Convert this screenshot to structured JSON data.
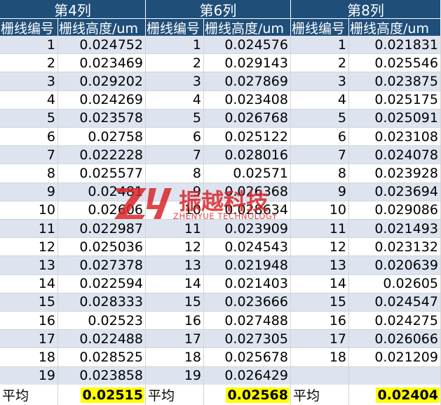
{
  "groups": [
    {
      "title": "第4列",
      "col_id": "栅线编号",
      "col_height": "栅线高度/um",
      "ids": [
        "1",
        "2",
        "3",
        "4",
        "5",
        "6",
        "7",
        "8",
        "9",
        "10",
        "11",
        "12",
        "13",
        "14",
        "15",
        "16",
        "17",
        "18",
        "19"
      ],
      "values": [
        "0.024752",
        "0.023469",
        "0.029202",
        "0.024269",
        "0.023578",
        "0.02758",
        "0.022228",
        "0.025577",
        "0.02481",
        "0.02606",
        "0.022987",
        "0.025036",
        "0.027378",
        "0.022594",
        "0.028333",
        "0.02523",
        "0.022488",
        "0.028525",
        "0.023858"
      ],
      "avg_label": "平均",
      "avg_value": "0.02515"
    },
    {
      "title": "第6列",
      "col_id": "栅线编号",
      "col_height": "栅线高度/um",
      "ids": [
        "1",
        "2",
        "3",
        "4",
        "5",
        "6",
        "7",
        "8",
        "9",
        "10",
        "11",
        "12",
        "13",
        "14",
        "15",
        "16",
        "17",
        "18",
        "19"
      ],
      "values": [
        "0.024576",
        "0.029143",
        "0.027869",
        "0.023408",
        "0.026768",
        "0.025122",
        "0.028016",
        "0.02571",
        "0.026368",
        "0.028634",
        "0.023909",
        "0.024543",
        "0.021948",
        "0.021403",
        "0.023666",
        "0.027488",
        "0.027305",
        "0.025678",
        "0.026429"
      ],
      "avg_label": "平均",
      "avg_value": "0.02568"
    },
    {
      "title": "第8列",
      "col_id": "栅线编号",
      "col_height": "栅线高度/um",
      "ids": [
        "1",
        "2",
        "3",
        "4",
        "5",
        "6",
        "7",
        "8",
        "9",
        "10",
        "11",
        "12",
        "13",
        "14",
        "15",
        "16",
        "17",
        "18",
        ""
      ],
      "values": [
        "0.021831",
        "0.025546",
        "0.023875",
        "0.025175",
        "0.025091",
        "0.023108",
        "0.024078",
        "0.023928",
        "0.023694",
        "0.029086",
        "0.021493",
        "0.023132",
        "0.020639",
        "0.02605",
        "0.024547",
        "0.024275",
        "0.026066",
        "0.021209",
        ""
      ],
      "avg_label": "平均",
      "avg_value": "0.02404"
    }
  ],
  "watermark": {
    "name": "振越科技",
    "subtitle": "ZHENYUE TECHNOLOGY"
  },
  "colors": {
    "header_bg": "#1f4e79",
    "band": "#dde4f0",
    "highlight": "#ffff00",
    "logo_red": "#d9262b"
  }
}
